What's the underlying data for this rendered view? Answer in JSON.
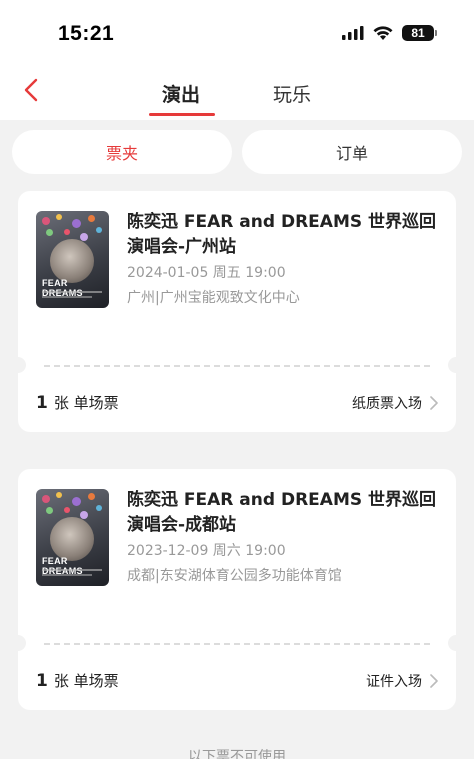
{
  "status_bar": {
    "time": "15:21",
    "battery": "81"
  },
  "nav": {
    "tabs": [
      {
        "label": "演出",
        "active": true
      },
      {
        "label": "玩乐",
        "active": false
      }
    ],
    "accent": "#e63a3a"
  },
  "segments": [
    {
      "label": "票夹",
      "active": true
    },
    {
      "label": "订单",
      "active": false
    }
  ],
  "tickets": [
    {
      "title": "陈奕迅 FEAR and DREAMS 世界巡回演唱会-广州站",
      "datetime": "2024-01-05 周五 19:00",
      "venue": "广州|广州宝能观致文化中心",
      "qty_num": "1",
      "qty_label": "张 单场票",
      "entry": "纸质票入场",
      "poster_text": "FEAR\nDREAMS"
    },
    {
      "title": "陈奕迅 FEAR and DREAMS 世界巡回演唱会-成都站",
      "datetime": "2023-12-09 周六 19:00",
      "venue": "成都|东安湖体育公园多功能体育馆",
      "qty_num": "1",
      "qty_label": "张 单场票",
      "entry": "证件入场",
      "poster_text": "FEAR\nDREAMS"
    }
  ],
  "footer_note": "以下票不可使用"
}
